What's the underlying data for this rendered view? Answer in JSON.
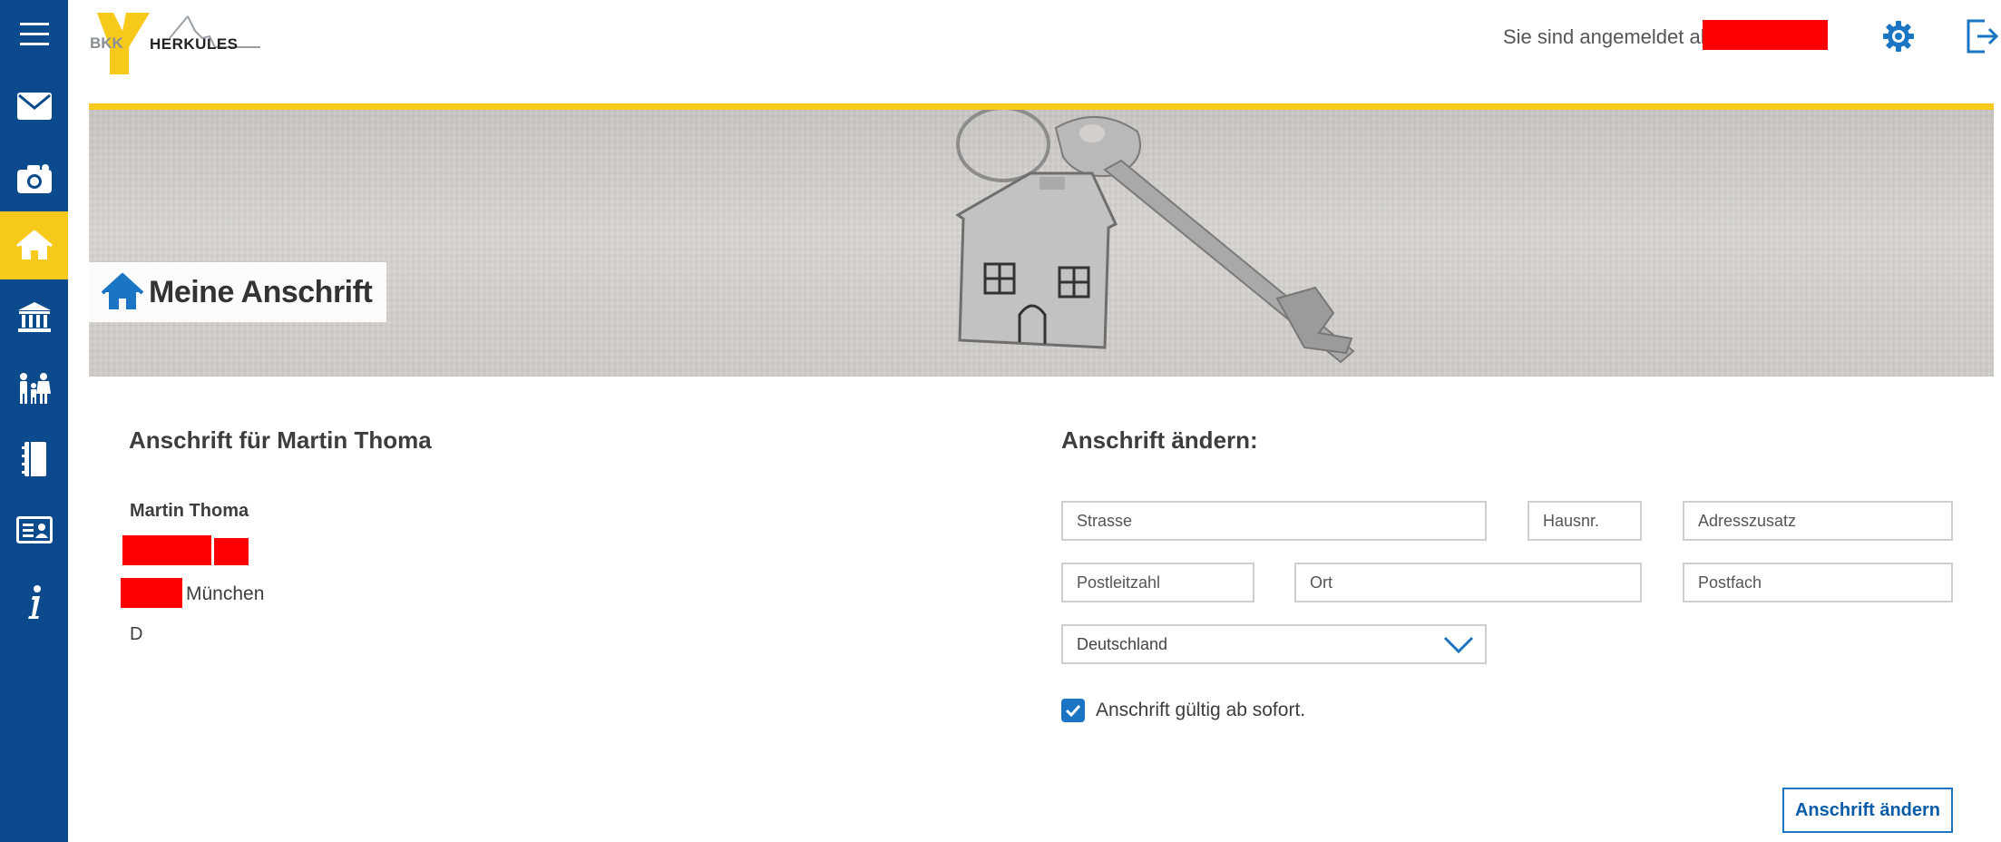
{
  "sidebar": {
    "items": [
      {
        "icon": "menu-icon",
        "active": false
      },
      {
        "icon": "mail-icon",
        "active": false
      },
      {
        "icon": "camera-icon",
        "active": false
      },
      {
        "icon": "home-icon",
        "active": true
      },
      {
        "icon": "bank-icon",
        "active": false
      },
      {
        "icon": "family-icon",
        "active": false
      },
      {
        "icon": "notebook-icon",
        "active": false
      },
      {
        "icon": "id-card-icon",
        "active": false
      },
      {
        "icon": "info-icon",
        "active": false
      }
    ],
    "colors": {
      "background": "#0b4a8c",
      "active": "#f7c91b"
    }
  },
  "header": {
    "logo_text_left": "BKK",
    "logo_text_right": "HERKULES",
    "logged_in_label": "Sie sind angemeldet als:",
    "icons": [
      "gear-icon",
      "logout-icon"
    ]
  },
  "banner": {
    "title": "Meine Anschrift",
    "title_icon": "home-icon",
    "accent": "#f7c91b"
  },
  "current_address": {
    "heading": "Anschrift für Martin Thoma",
    "name": "Martin Thoma",
    "city": "München",
    "country": "D"
  },
  "change_form": {
    "heading": "Anschrift ändern:",
    "street_placeholder": "Strasse",
    "house_no_placeholder": "Hausnr.",
    "addition_placeholder": "Adresszusatz",
    "zip_placeholder": "Postleitzahl",
    "city_placeholder": "Ort",
    "po_box_placeholder": "Postfach",
    "country_selected": "Deutschland",
    "valid_checkbox_label": "Anschrift gültig ab sofort.",
    "valid_checked": true,
    "submit_label": "Anschrift ändern",
    "accent": "#1a76c4"
  }
}
